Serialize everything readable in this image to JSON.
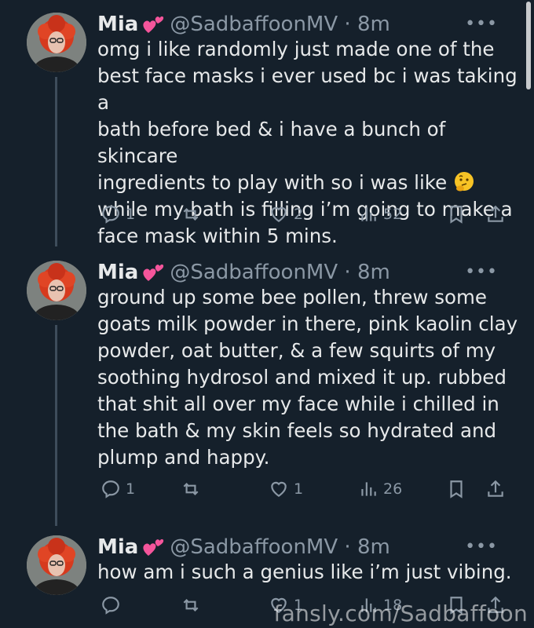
{
  "tweets": [
    {
      "name": "Mia",
      "handle_time": "@SadbaffoonMV · 8m",
      "lines": [
        "omg i like randomly just made one of the",
        "best face masks i ever used bc i was taking a",
        "bath before bed & i have a bunch of skincare",
        "ingredients to play with so i was like",
        "while my bath is filling i’m going to make a",
        "face mask within 5 mins."
      ],
      "replies": "1",
      "retweets": "",
      "likes": "2",
      "views": "52"
    },
    {
      "name": "Mia",
      "handle_time": "@SadbaffoonMV · 8m",
      "lines": [
        "ground up some bee pollen, threw some",
        "goats milk powder in there, pink kaolin clay",
        "powder, oat butter, & a few squirts of my",
        "soothing hydrosol and mixed it up. rubbed",
        "that shit all over my face while i chilled in",
        "the bath & my skin feels so hydrated and",
        "plump and happy."
      ],
      "replies": "1",
      "retweets": "",
      "likes": "1",
      "views": "26"
    },
    {
      "name": "Mia",
      "handle_time": "@SadbaffoonMV · 8m",
      "lines": [
        "how am i such a genius like i’m just vibing."
      ],
      "replies": "",
      "retweets": "",
      "likes": "1",
      "views": "18"
    }
  ],
  "more_label": "•••",
  "watermark": "fansly.com/Sadbaffoon",
  "icons": {
    "name_emoji": "two-hearts-icon",
    "thinking": "thinking-face-icon"
  },
  "colors": {
    "background": "#15202b",
    "secondary": "#8b98a5",
    "heart": "#f5559b"
  }
}
